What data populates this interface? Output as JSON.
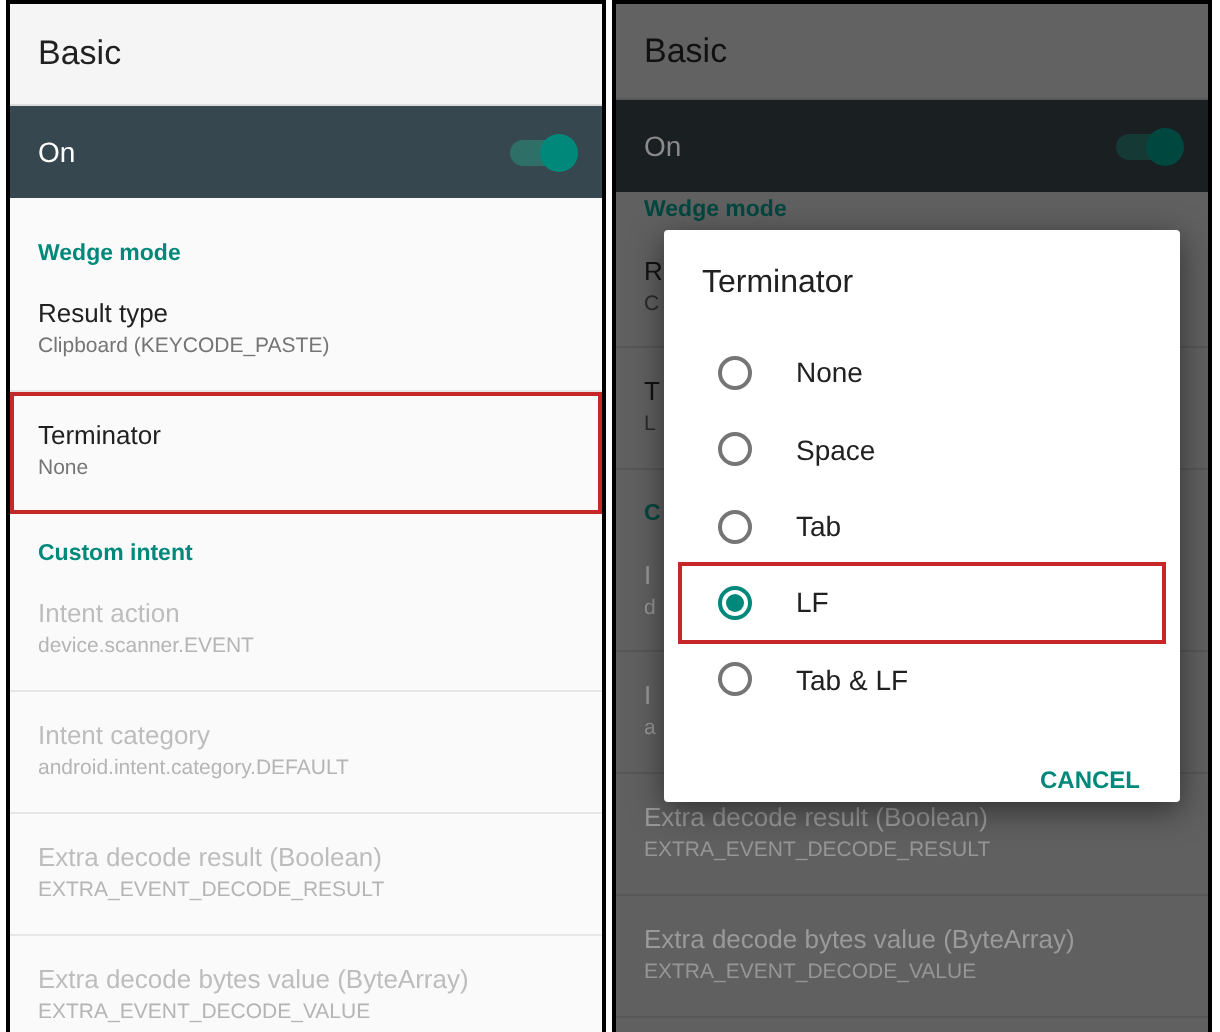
{
  "panels": [
    {
      "title": "Basic",
      "master": {
        "label": "On",
        "on": true
      },
      "dimmed": false,
      "items": [
        {
          "kind": "header",
          "label": "Wedge mode"
        },
        {
          "kind": "pref",
          "title": "Result type",
          "summary": "Clipboard (KEYCODE_PASTE)",
          "disabled": false,
          "highlighted": false
        },
        {
          "kind": "pref",
          "title": "Terminator",
          "summary": "None",
          "disabled": false,
          "highlighted": true
        },
        {
          "kind": "header",
          "label": "Custom intent"
        },
        {
          "kind": "pref",
          "title": "Intent action",
          "summary": "device.scanner.EVENT",
          "disabled": true,
          "highlighted": false
        },
        {
          "kind": "pref",
          "title": "Intent category",
          "summary": "android.intent.category.DEFAULT",
          "disabled": true,
          "highlighted": false
        },
        {
          "kind": "pref",
          "title": "Extra decode result (Boolean)",
          "summary": "EXTRA_EVENT_DECODE_RESULT",
          "disabled": true,
          "highlighted": false
        },
        {
          "kind": "pref",
          "title": "Extra decode bytes value (ByteArray)",
          "summary": "EXTRA_EVENT_DECODE_VALUE",
          "disabled": true,
          "highlighted": false
        }
      ]
    },
    {
      "title": "Basic",
      "master": {
        "label": "On",
        "on": true
      },
      "dimmed": true,
      "items": [
        {
          "kind": "header",
          "label": "Wedge mode"
        },
        {
          "kind": "pref",
          "title": "R",
          "summary": "C",
          "disabled": false,
          "highlighted": false
        },
        {
          "kind": "pref",
          "title": "T",
          "summary": "L",
          "disabled": false,
          "highlighted": false
        },
        {
          "kind": "header",
          "label": "C"
        },
        {
          "kind": "pref",
          "title": "I",
          "summary": "d",
          "disabled": true,
          "highlighted": false
        },
        {
          "kind": "pref",
          "title": "I",
          "summary": "a",
          "disabled": true,
          "highlighted": false
        },
        {
          "kind": "pref",
          "title": "Extra decode result (Boolean)",
          "summary": "EXTRA_EVENT_DECODE_RESULT",
          "disabled": true,
          "highlighted": false
        },
        {
          "kind": "pref",
          "title": "Extra decode bytes value (ByteArray)",
          "summary": "EXTRA_EVENT_DECODE_VALUE",
          "disabled": true,
          "highlighted": false
        }
      ],
      "dialog": {
        "title": "Terminator",
        "options": [
          {
            "label": "None",
            "selected": false,
            "highlighted": false
          },
          {
            "label": "Space",
            "selected": false,
            "highlighted": false
          },
          {
            "label": "Tab",
            "selected": false,
            "highlighted": false
          },
          {
            "label": "LF",
            "selected": true,
            "highlighted": true
          },
          {
            "label": "Tab & LF",
            "selected": false,
            "highlighted": false
          }
        ],
        "button": "CANCEL"
      }
    }
  ]
}
